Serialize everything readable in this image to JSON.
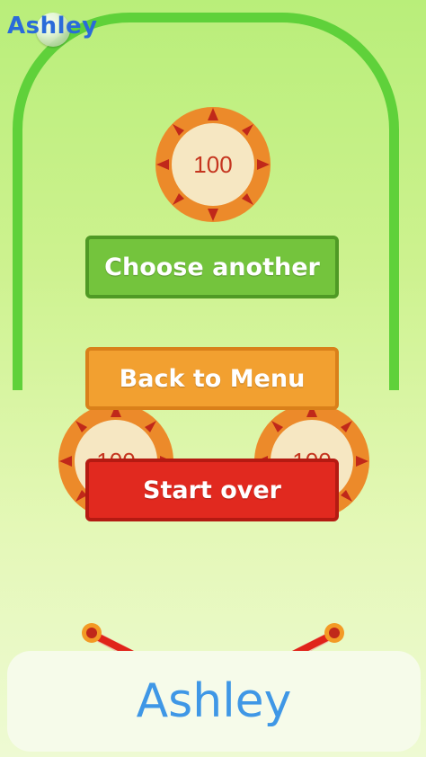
{
  "player": {
    "name": "Ashley"
  },
  "bumpers": {
    "top_value": "100",
    "left_value": "100",
    "right_value": "100"
  },
  "buttons": {
    "choose_another": "Choose another",
    "back_to_menu": "Back to Menu",
    "start_over": "Start over"
  },
  "colors": {
    "track": "#5fd13a",
    "green_button": "#74c43d",
    "orange_button": "#f2a030",
    "red_button": "#e1291f",
    "name_text": "#3f97e6",
    "player_label": "#2a6bd9"
  }
}
